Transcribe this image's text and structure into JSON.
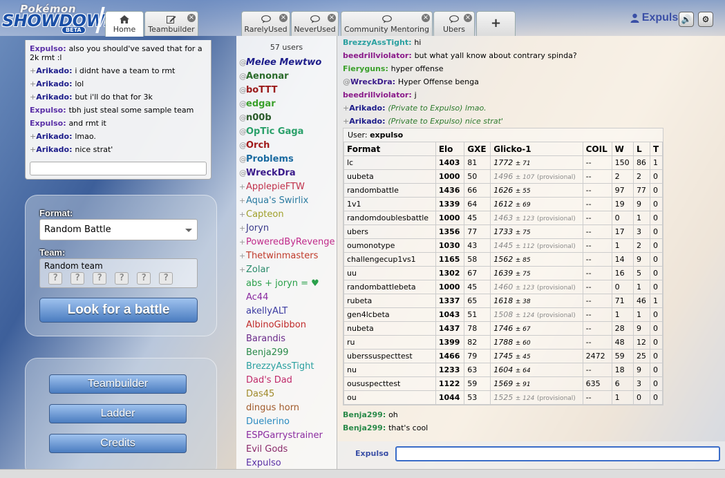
{
  "logo": {
    "pokemon": "Pokémon",
    "showdown": "SHOWDOWN",
    "beta": "BETA"
  },
  "tabs": [
    {
      "label": "Home",
      "icon": "home-icon",
      "closable": false
    },
    {
      "label": "Teambuilder",
      "icon": "edit-icon",
      "closable": true
    },
    {
      "label": "RarelyUsed",
      "icon": "chat-bubble-icon",
      "closable": true
    },
    {
      "label": "NeverUsed",
      "icon": "chat-bubble-icon",
      "closable": true
    },
    {
      "label": "Community Mentoring",
      "icon": "chat-bubble-icon",
      "closable": true
    },
    {
      "label": "Ubers",
      "icon": "chat-bubble-icon",
      "closable": true
    }
  ],
  "add_tab": "+",
  "user": {
    "name": "Expulso"
  },
  "mini_chat": [
    {
      "name": "Expulso",
      "rank": "",
      "color": "#5a2fa6",
      "text": "also you should've saved that for a 2k rmt :l"
    },
    {
      "name": "Arikado",
      "rank": "+",
      "color": "#1d1d8a",
      "text": "i didnt have a team to rmt"
    },
    {
      "name": "Arikado",
      "rank": "+",
      "color": "#1d1d8a",
      "text": "lol"
    },
    {
      "name": "Arikado",
      "rank": "+",
      "color": "#1d1d8a",
      "text": "but i'll do that for 3k"
    },
    {
      "name": "Expulso",
      "rank": "",
      "color": "#5a2fa6",
      "text": "tbh just steal some sample team"
    },
    {
      "name": "Expulso",
      "rank": "",
      "color": "#5a2fa6",
      "text": "and rmt it"
    },
    {
      "name": "Arikado",
      "rank": "+",
      "color": "#1d1d8a",
      "text": "lmao."
    },
    {
      "name": "Arikado",
      "rank": "+",
      "color": "#1d1d8a",
      "text": "nice strat'"
    }
  ],
  "battle_form": {
    "format_label": "Format:",
    "format_value": "Random Battle",
    "team_label": "Team:",
    "team_value": "Random team",
    "look_button": "Look for a battle"
  },
  "menu": {
    "teambuilder": "Teambuilder",
    "ladder": "Ladder",
    "credits": "Credits"
  },
  "userlist": {
    "count": "57 users",
    "users": [
      {
        "rank": "@",
        "name": "Melee Mewtwo",
        "color": "#1d1d8a",
        "bold": true,
        "italic": true
      },
      {
        "rank": "@",
        "name": "Aenonar",
        "color": "#2a6a2a",
        "bold": true,
        "italic": false
      },
      {
        "rank": "@",
        "name": "boTTT",
        "color": "#9a1a1a",
        "bold": true,
        "italic": false
      },
      {
        "rank": "@",
        "name": "edgar",
        "color": "#3aa02a",
        "bold": true,
        "italic": false
      },
      {
        "rank": "@",
        "name": "n00b",
        "color": "#2a5a2a",
        "bold": true,
        "italic": false
      },
      {
        "rank": "@",
        "name": "OpTic Gaga",
        "color": "#2aa06a",
        "bold": true,
        "italic": false
      },
      {
        "rank": "@",
        "name": "Orch",
        "color": "#a01a1a",
        "bold": true,
        "italic": false
      },
      {
        "rank": "@",
        "name": "Problems",
        "color": "#1a6aa0",
        "bold": true,
        "italic": false
      },
      {
        "rank": "@",
        "name": "WreckDra",
        "color": "#3a1a8a",
        "bold": true,
        "italic": false
      },
      {
        "rank": "+",
        "name": "ApplepieFTW",
        "color": "#c0304a",
        "bold": false,
        "italic": false
      },
      {
        "rank": "+",
        "name": "Aqua's Swirlix",
        "color": "#2a7aa0",
        "bold": false,
        "italic": false
      },
      {
        "rank": "+",
        "name": "Capteon",
        "color": "#a0a02a",
        "bold": false,
        "italic": false
      },
      {
        "rank": "+",
        "name": "Joryn",
        "color": "#3a3a8a",
        "bold": false,
        "italic": false
      },
      {
        "rank": "+",
        "name": "PoweredByRevenge",
        "color": "#c02a8a",
        "bold": false,
        "italic": false
      },
      {
        "rank": "+",
        "name": "Thetwinmasters",
        "color": "#c03a2a",
        "bold": false,
        "italic": false
      },
      {
        "rank": "+",
        "name": "Zolar",
        "color": "#2a8a6a",
        "bold": false,
        "italic": false
      },
      {
        "rank": "",
        "name": "abs + joryn = ♥",
        "color": "#2aa04a",
        "bold": false,
        "italic": false
      },
      {
        "rank": "",
        "name": "Ac44",
        "color": "#8a2aa0",
        "bold": false,
        "italic": false
      },
      {
        "rank": "",
        "name": "akellyALT",
        "color": "#3a3aa0",
        "bold": false,
        "italic": false
      },
      {
        "rank": "",
        "name": "AlbinoGibbon",
        "color": "#c02a2a",
        "bold": false,
        "italic": false
      },
      {
        "rank": "",
        "name": "Barandis",
        "color": "#6a2a8a",
        "bold": false,
        "italic": false
      },
      {
        "rank": "",
        "name": "Benja299",
        "color": "#2a8a4a",
        "bold": false,
        "italic": false
      },
      {
        "rank": "",
        "name": "BrezzyAssTight",
        "color": "#2aa0a0",
        "bold": false,
        "italic": false
      },
      {
        "rank": "",
        "name": "Dad's Dad",
        "color": "#c02a6a",
        "bold": false,
        "italic": false
      },
      {
        "rank": "",
        "name": "Das45",
        "color": "#a08a2a",
        "bold": false,
        "italic": false
      },
      {
        "rank": "",
        "name": "dingus horn",
        "color": "#a05a2a",
        "bold": false,
        "italic": false
      },
      {
        "rank": "",
        "name": "Duelerino",
        "color": "#2a8ac0",
        "bold": false,
        "italic": false
      },
      {
        "rank": "",
        "name": "ESPGarrystrainer",
        "color": "#8a2aa0",
        "bold": false,
        "italic": false
      },
      {
        "rank": "",
        "name": "Evil Gods",
        "color": "#8a2a6a",
        "bold": false,
        "italic": false
      },
      {
        "rank": "",
        "name": "Expulso",
        "color": "#5a2fa6",
        "bold": false,
        "italic": false
      }
    ]
  },
  "chat_top": [
    {
      "rank": "",
      "name": "BrezzyAssTight",
      "color": "#2aa0a0",
      "text": "hi",
      "pm": false
    },
    {
      "rank": "",
      "name": "beedrillviolator",
      "color": "#8a1a8a",
      "text": "but what yall know about contrary spinda?",
      "pm": false
    },
    {
      "rank": "",
      "name": "Fieryguns",
      "color": "#3aa02a",
      "text": "hyper offense",
      "pm": false
    },
    {
      "rank": "@",
      "name": "WreckDra",
      "color": "#3a1a8a",
      "text": "Hyper Offense benga",
      "pm": false
    },
    {
      "rank": "",
      "name": "beedrillviolator",
      "color": "#8a1a8a",
      "text": "j",
      "pm": false
    },
    {
      "rank": "+",
      "name": "Arikado",
      "color": "#1d1d8a",
      "text": "(Private to Expulso) lmao.",
      "pm": true
    },
    {
      "rank": "+",
      "name": "Arikado",
      "color": "#1d1d8a",
      "text": "(Private to Expulso) nice strat'",
      "pm": true
    }
  ],
  "stats": {
    "user_label": "User:",
    "user_name": "expulso",
    "headers": [
      "Format",
      "Elo",
      "GXE",
      "Glicko-1",
      "COIL",
      "W",
      "L",
      "T"
    ],
    "rows": [
      {
        "format": "lc",
        "elo": "1403",
        "gxe": "81",
        "glicko": "1772",
        "dev": "± 71",
        "prov": false,
        "coil": "--",
        "w": "150",
        "l": "86",
        "t": "1"
      },
      {
        "format": "uubeta",
        "elo": "1000",
        "gxe": "50",
        "glicko": "1496",
        "dev": "± 107",
        "prov": true,
        "coil": "--",
        "w": "2",
        "l": "2",
        "t": "0"
      },
      {
        "format": "randombattle",
        "elo": "1436",
        "gxe": "66",
        "glicko": "1626",
        "dev": "± 55",
        "prov": false,
        "coil": "--",
        "w": "97",
        "l": "77",
        "t": "0"
      },
      {
        "format": "1v1",
        "elo": "1339",
        "gxe": "64",
        "glicko": "1612",
        "dev": "± 69",
        "prov": false,
        "coil": "--",
        "w": "19",
        "l": "9",
        "t": "0"
      },
      {
        "format": "randomdoublesbattle",
        "elo": "1000",
        "gxe": "45",
        "glicko": "1463",
        "dev": "± 123",
        "prov": true,
        "coil": "--",
        "w": "0",
        "l": "1",
        "t": "0"
      },
      {
        "format": "ubers",
        "elo": "1356",
        "gxe": "77",
        "glicko": "1733",
        "dev": "± 75",
        "prov": false,
        "coil": "--",
        "w": "17",
        "l": "3",
        "t": "0"
      },
      {
        "format": "oumonotype",
        "elo": "1030",
        "gxe": "43",
        "glicko": "1445",
        "dev": "± 112",
        "prov": true,
        "coil": "--",
        "w": "1",
        "l": "2",
        "t": "0"
      },
      {
        "format": "challengecup1vs1",
        "elo": "1165",
        "gxe": "58",
        "glicko": "1562",
        "dev": "± 85",
        "prov": false,
        "coil": "--",
        "w": "14",
        "l": "9",
        "t": "0"
      },
      {
        "format": "uu",
        "elo": "1302",
        "gxe": "67",
        "glicko": "1639",
        "dev": "± 75",
        "prov": false,
        "coil": "--",
        "w": "16",
        "l": "5",
        "t": "0"
      },
      {
        "format": "randombattlebeta",
        "elo": "1000",
        "gxe": "45",
        "glicko": "1460",
        "dev": "± 123",
        "prov": true,
        "coil": "--",
        "w": "0",
        "l": "1",
        "t": "0"
      },
      {
        "format": "rubeta",
        "elo": "1337",
        "gxe": "65",
        "glicko": "1618",
        "dev": "± 38",
        "prov": false,
        "coil": "--",
        "w": "71",
        "l": "46",
        "t": "1"
      },
      {
        "format": "gen4lcbeta",
        "elo": "1043",
        "gxe": "51",
        "glicko": "1508",
        "dev": "± 124",
        "prov": true,
        "coil": "--",
        "w": "1",
        "l": "1",
        "t": "0"
      },
      {
        "format": "nubeta",
        "elo": "1437",
        "gxe": "78",
        "glicko": "1746",
        "dev": "± 67",
        "prov": false,
        "coil": "--",
        "w": "28",
        "l": "9",
        "t": "0"
      },
      {
        "format": "ru",
        "elo": "1399",
        "gxe": "82",
        "glicko": "1788",
        "dev": "± 60",
        "prov": false,
        "coil": "--",
        "w": "48",
        "l": "12",
        "t": "0"
      },
      {
        "format": "uberssuspecttest",
        "elo": "1466",
        "gxe": "79",
        "glicko": "1745",
        "dev": "± 45",
        "prov": false,
        "coil": "2472",
        "w": "59",
        "l": "25",
        "t": "0"
      },
      {
        "format": "nu",
        "elo": "1233",
        "gxe": "63",
        "glicko": "1604",
        "dev": "± 64",
        "prov": false,
        "coil": "--",
        "w": "18",
        "l": "9",
        "t": "0"
      },
      {
        "format": "oususpecttest",
        "elo": "1122",
        "gxe": "59",
        "glicko": "1569",
        "dev": "± 91",
        "prov": false,
        "coil": "635",
        "w": "6",
        "l": "3",
        "t": "0"
      },
      {
        "format": "ou",
        "elo": "1044",
        "gxe": "53",
        "glicko": "1525",
        "dev": "± 124",
        "prov": true,
        "coil": "--",
        "w": "1",
        "l": "0",
        "t": "0"
      }
    ],
    "provisional_label": "(provisional)"
  },
  "chat_bottom": [
    {
      "rank": "",
      "name": "Benja299",
      "color": "#2a8a4a",
      "text": "oh"
    },
    {
      "rank": "",
      "name": "Benja299",
      "color": "#2a8a4a",
      "text": "that's cool"
    }
  ],
  "chatbox": {
    "name": "Expulso"
  }
}
